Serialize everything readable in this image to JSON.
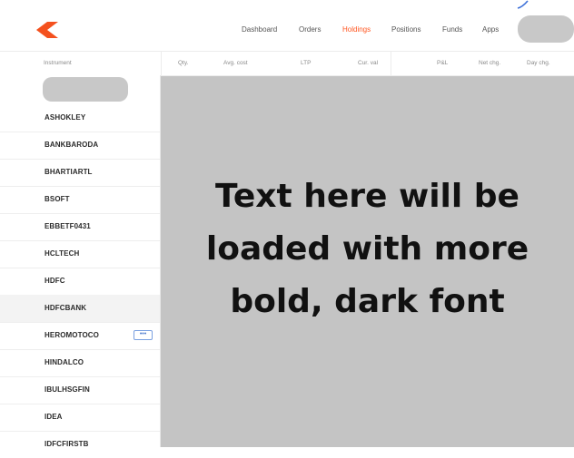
{
  "nav": {
    "items": [
      {
        "label": "Dashboard",
        "active": false
      },
      {
        "label": "Orders",
        "active": false
      },
      {
        "label": "Holdings",
        "active": true
      },
      {
        "label": "Positions",
        "active": false
      },
      {
        "label": "Funds",
        "active": false
      },
      {
        "label": "Apps",
        "active": false
      }
    ],
    "logo_icon": "kite-logo-icon"
  },
  "table": {
    "columns": [
      "Instrument",
      "Qty.",
      "Avg. cost",
      "LTP",
      "Cur. val",
      "P&L",
      "Net chg.",
      "Day chg."
    ]
  },
  "instruments": [
    {
      "name": "ASHOKLEY"
    },
    {
      "name": "BANKBARODA"
    },
    {
      "name": "BHARTIARTL"
    },
    {
      "name": "BSOFT"
    },
    {
      "name": "EBBETF0431"
    },
    {
      "name": "HCLTECH"
    },
    {
      "name": "HDFC"
    },
    {
      "name": "HDFCBANK",
      "highlighted": true
    },
    {
      "name": "HEROMOTOCO",
      "more_label": "•••"
    },
    {
      "name": "HINDALCO"
    },
    {
      "name": "IBULHSGFIN"
    },
    {
      "name": "IDEA"
    },
    {
      "name": "IDFCFIRSTB"
    }
  ],
  "content": {
    "line1": "Text here will be",
    "line2": "loaded with more",
    "line3": "bold, dark font"
  },
  "colors": {
    "accent": "#ff5722",
    "placeholder_grey": "#c4c4c4",
    "link_blue": "#4a78cc"
  }
}
